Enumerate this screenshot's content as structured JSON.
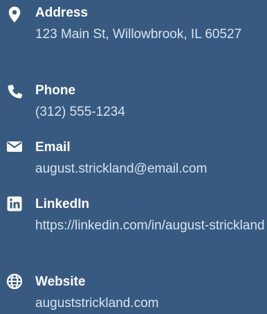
{
  "contact": {
    "items": [
      {
        "icon": "location-pin-icon",
        "label": "Address",
        "value": "123 Main St, Willowbrook, IL 60527"
      },
      {
        "icon": "phone-icon",
        "label": "Phone",
        "value": "(312) 555-1234"
      },
      {
        "icon": "envelope-icon",
        "label": "Email",
        "value": "august.strickland@email.com"
      },
      {
        "icon": "linkedin-icon",
        "label": "LinkedIn",
        "value": "https://linkedin.com/in/august-strickland"
      },
      {
        "icon": "globe-icon",
        "label": "Website",
        "value": "auguststrickland.com"
      }
    ]
  },
  "colors": {
    "background": "#385a80",
    "label": "#ffffff",
    "value": "#d6e4f3"
  }
}
